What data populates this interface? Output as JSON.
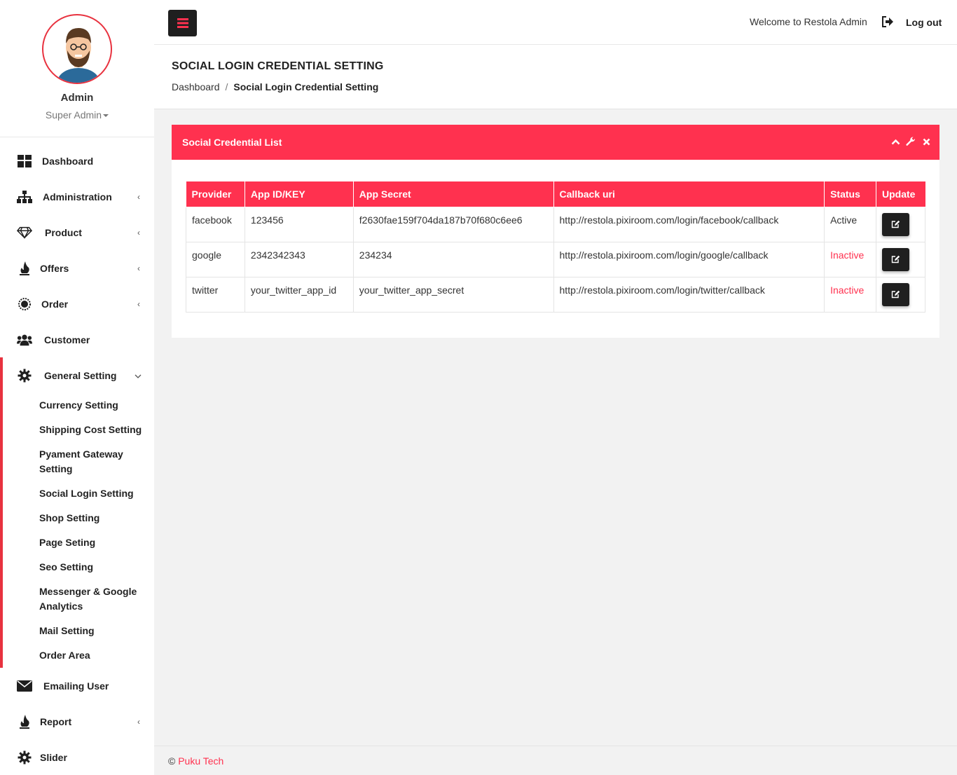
{
  "profile": {
    "name": "Admin",
    "role": "Super Admin"
  },
  "sidebar": {
    "items": [
      {
        "label": "Dashboard"
      },
      {
        "label": "Administration"
      },
      {
        "label": "Product"
      },
      {
        "label": "Offers"
      },
      {
        "label": "Order"
      },
      {
        "label": "Customer"
      },
      {
        "label": "General Setting"
      },
      {
        "label": "Emailing User"
      },
      {
        "label": "Report"
      },
      {
        "label": "Slider"
      }
    ],
    "subitems": [
      {
        "label": "Currency Setting"
      },
      {
        "label": "Shipping Cost Setting"
      },
      {
        "label": "Pyament Gateway Setting"
      },
      {
        "label": "Social Login Setting"
      },
      {
        "label": "Shop Setting"
      },
      {
        "label": "Page Seting"
      },
      {
        "label": "Seo Setting"
      },
      {
        "label": "Messenger & Google Analytics"
      },
      {
        "label": "Mail Setting"
      },
      {
        "label": "Order Area"
      }
    ]
  },
  "topbar": {
    "welcome": "Welcome to Restola Admin",
    "logout": "Log out"
  },
  "page": {
    "title": "SOCIAL LOGIN CREDENTIAL SETTING",
    "breadcrumb": {
      "home": "Dashboard",
      "separator": "/",
      "current": "Social Login Credential Setting"
    }
  },
  "card": {
    "title": "Social Credential List",
    "columns": [
      "Provider",
      "App ID/KEY",
      "App Secret",
      "Callback uri",
      "Status",
      "Update"
    ],
    "rows": [
      {
        "provider": "facebook",
        "app_id": "123456",
        "app_secret": "f2630fae159f704da187b70f680c6ee6",
        "callback": "http://restola.pixiroom.com/login/facebook/callback",
        "status": "Active"
      },
      {
        "provider": "google",
        "app_id": "2342342343",
        "app_secret": "234234",
        "callback": "http://restola.pixiroom.com/login/google/callback",
        "status": "Inactive"
      },
      {
        "provider": "twitter",
        "app_id": "your_twitter_app_id",
        "app_secret": "your_twitter_app_secret",
        "callback": "http://restola.pixiroom.com/login/twitter/callback",
        "status": "Inactive"
      }
    ]
  },
  "footer": {
    "copyright": "©",
    "company": "Puku Tech"
  },
  "colors": {
    "accent": "#ff314f",
    "dark_button": "#1f1f1f",
    "inactive": "#ff314f"
  },
  "icons": [
    "hamburger-icon",
    "logout-icon",
    "chevron-up-icon",
    "wrench-icon",
    "close-icon",
    "edit-icon"
  ]
}
